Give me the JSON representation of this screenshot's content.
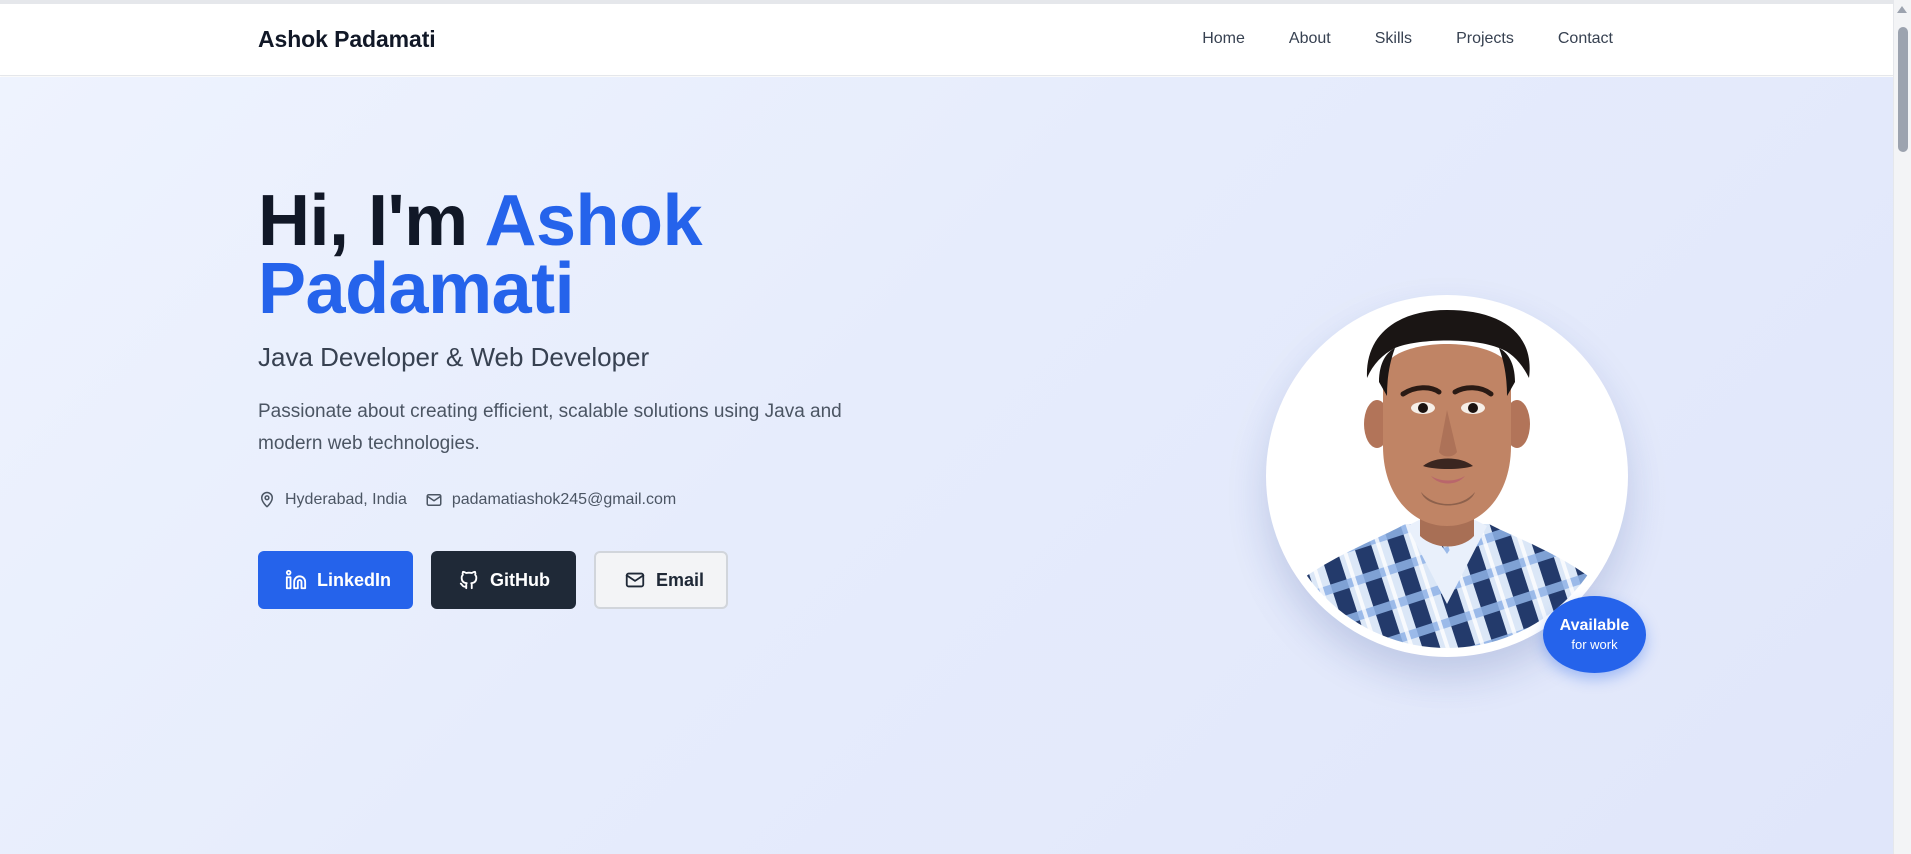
{
  "header": {
    "brand": "Ashok Padamati",
    "nav": [
      "Home",
      "About",
      "Skills",
      "Projects",
      "Contact"
    ]
  },
  "hero": {
    "greeting": "Hi, I'm",
    "name_first": "Ashok",
    "name_last": "Padamati",
    "subtitle": "Java Developer & Web Developer",
    "description": "Passionate about creating efficient, scalable solutions using Java and modern web technologies.",
    "location": "Hyderabad, India",
    "email": "padamatiashok245@gmail.com",
    "buttons": {
      "linkedin": "LinkedIn",
      "github": "GitHub",
      "email": "Email"
    },
    "badge": {
      "line1": "Available",
      "line2": "for work"
    }
  },
  "icons": {
    "location": "map-pin-icon",
    "email": "mail-icon",
    "linkedin": "linkedin-icon",
    "github": "github-icon"
  },
  "colors": {
    "accent": "#2563eb",
    "dark_button": "#1f2937",
    "heading": "#111827",
    "body_text": "#4b5563"
  }
}
